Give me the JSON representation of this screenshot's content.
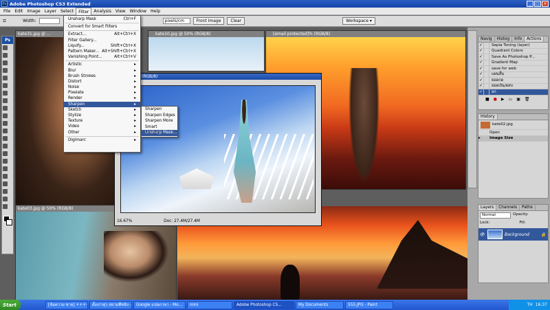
{
  "app": {
    "title": "Adobe Photoshop CS3 Extended",
    "badge": "Ps"
  },
  "menubar": [
    "File",
    "Edit",
    "Image",
    "Layer",
    "Select",
    "Filter",
    "Analysis",
    "View",
    "Window",
    "Help"
  ],
  "options": {
    "width_label": "Width:",
    "mode_value": "pixels/cm",
    "front_image": "Front Image",
    "clear": "Clear",
    "workspace": "Workspace ▾"
  },
  "filter_menu": {
    "top": [
      {
        "label": "Unsharp Mask",
        "shortcut": "Ctrl+F"
      }
    ],
    "convert": "Convert for Smart Filters",
    "group2": [
      {
        "label": "Extract...",
        "shortcut": "Alt+Ctrl+X"
      },
      {
        "label": "Filter Gallery...",
        "shortcut": ""
      },
      {
        "label": "Liquify...",
        "shortcut": "Shift+Ctrl+X"
      },
      {
        "label": "Pattern Maker...",
        "shortcut": "Alt+Shift+Ctrl+X"
      },
      {
        "label": "Vanishing Point...",
        "shortcut": "Alt+Ctrl+V"
      }
    ],
    "group3": [
      "Artistic",
      "Blur",
      "Brush Strokes",
      "Distort",
      "Noise",
      "Pixelate",
      "Render",
      "Sharpen",
      "Sketch",
      "Stylize",
      "Texture",
      "Video",
      "Other"
    ],
    "last": "Digimarc"
  },
  "sharpen_submenu": [
    "Sharpen",
    "Sharpen Edges",
    "Sharpen More",
    "Smart Sharpen...",
    "Unsharp Mask..."
  ],
  "documents": [
    {
      "title": "kate31.jpg @ ..."
    },
    {
      "title": "kate10.jpg @ 50% (RGB/8)"
    },
    {
      "title": "[email protected]% (RGB/8)"
    },
    {
      "title": "@ 16.7% (RGB/8)"
    },
    {
      "title": "kate03.jpg @ 50% (RGB/8)"
    }
  ],
  "active_status": {
    "zoom": "16.67%",
    "doc": "Doc: 27.4M/27.4M"
  },
  "actions_panel": {
    "tabs": [
      "Navig",
      "Histog",
      "Info",
      "Actions"
    ],
    "items": [
      "Sepia Toning (layer)",
      "Quadrant Colors",
      "Save As Photoshop P...",
      "Gradient Map",
      "save for web",
      "แผนสั้น",
      "ยอดกด",
      "ยอดเงิน/ผลบ",
      "ยก"
    ]
  },
  "history_panel": {
    "tab": "History",
    "snapshot": "kate02.jpg",
    "items": [
      "Open",
      "Image Size"
    ]
  },
  "layers_panel": {
    "tabs": [
      "Layers",
      "Channels",
      "Paths"
    ],
    "blend": "Normal",
    "opacity": "Opacity:",
    "lock": "Lock:",
    "fill": "Fill:",
    "layer": "Background"
  },
  "taskbar": {
    "start": "Start",
    "tasks": [
      "[ข้อความ ซาย] ++++...",
      "ดั้งเก่าทุ่ว สยามพืชจับ - ...",
      "Google แปลภาษา - Mo...",
      "mini",
      "Adobe Photoshop CS...",
      "My Documents",
      "555.JPG - Paint"
    ],
    "tray_lang": "TH",
    "clock": "16:37"
  },
  "colors": {
    "title": "#1443a8",
    "menu_sel": "#33579b",
    "taskbar": "#2457d0"
  }
}
